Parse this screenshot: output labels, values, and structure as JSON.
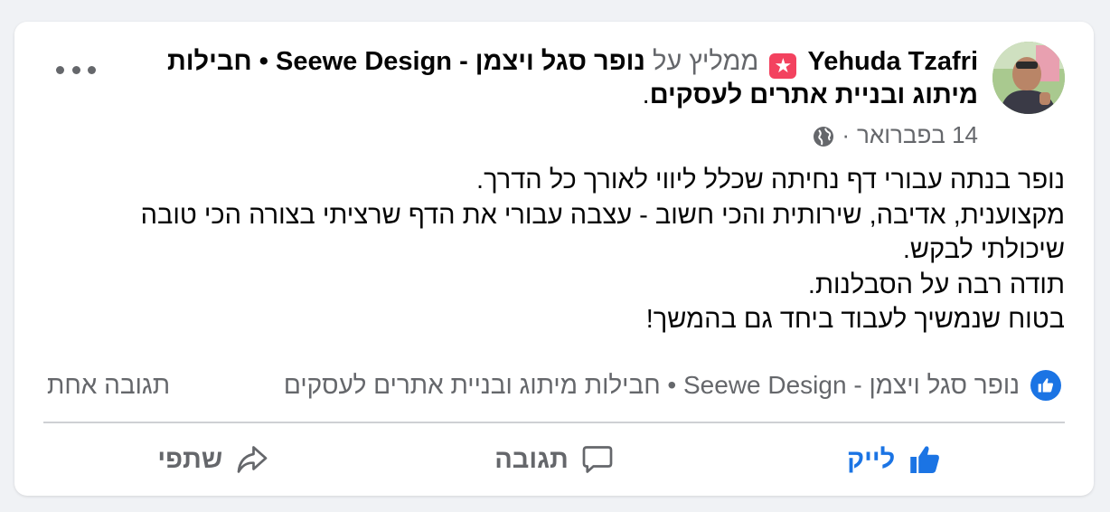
{
  "post": {
    "author": "Yehuda Tzafri",
    "recommends_text": "ממליץ על",
    "page_name": "נופר סגל ויצמן - Seewe Design • חבילות מיתוג ובניית אתרים לעסקים",
    "period": ".",
    "date": "14 בפברואר",
    "separator": "·",
    "body_lines": [
      "נופר בנתה עבורי דף נחיתה שכלל ליווי לאורך כל הדרך.",
      "מקצוענית, אדיבה, שירותית והכי חשוב - עצבה עבורי את הדף שרציתי בצורה הכי טובה שיכולתי לבקש.",
      "תודה רבה על הסבלנות.",
      "בטוח שנמשיך לעבוד ביחד גם בהמשך!"
    ]
  },
  "reactions": {
    "reactor_names": "נופר סגל ויצמן - Seewe Design • חבילות מיתוג ובניית אתרים לעסקים",
    "comment_count": "תגובה אחת"
  },
  "actions": {
    "like": "לייק",
    "comment": "תגובה",
    "share": "שתפי"
  },
  "icons": {
    "badge": "recommendation-star-icon",
    "privacy": "globe-icon",
    "more": "more-options-icon"
  },
  "colors": {
    "accent": "#1b74e4",
    "badge": "#f3425f",
    "secondary_text": "#65676b"
  }
}
